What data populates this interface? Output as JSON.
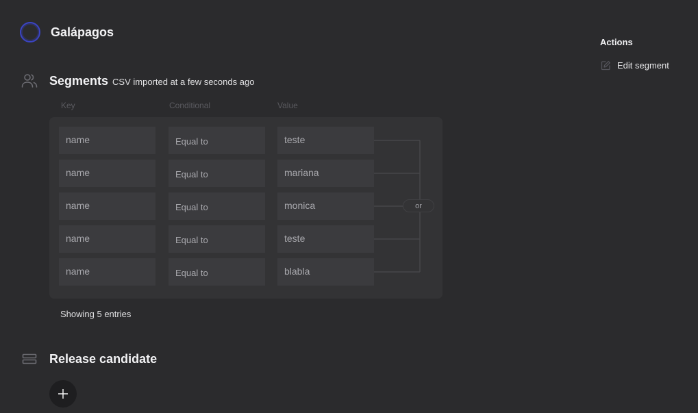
{
  "project": {
    "title": "Galápagos",
    "avatar_color": "#3b45c4"
  },
  "segments": {
    "title": "Segments",
    "subtitle": "CSV imported at a few seconds ago",
    "icon": "users-icon",
    "columns": {
      "key": "Key",
      "conditional": "Conditional",
      "value": "Value"
    },
    "rules": [
      {
        "key": "name",
        "conditional": "Equal to",
        "value": "teste"
      },
      {
        "key": "name",
        "conditional": "Equal to",
        "value": "mariana"
      },
      {
        "key": "name",
        "conditional": "Equal to",
        "value": "monica"
      },
      {
        "key": "name",
        "conditional": "Equal to",
        "value": "teste"
      },
      {
        "key": "name",
        "conditional": "Equal to",
        "value": "blabla"
      }
    ],
    "operator": "or",
    "entries_text": "Showing 5 entries"
  },
  "release": {
    "title": "Release candidate",
    "icon": "list-icon",
    "add_icon": "plus-icon"
  },
  "actions": {
    "title": "Actions",
    "items": [
      {
        "label": "Edit segment",
        "icon": "edit-icon"
      }
    ]
  }
}
